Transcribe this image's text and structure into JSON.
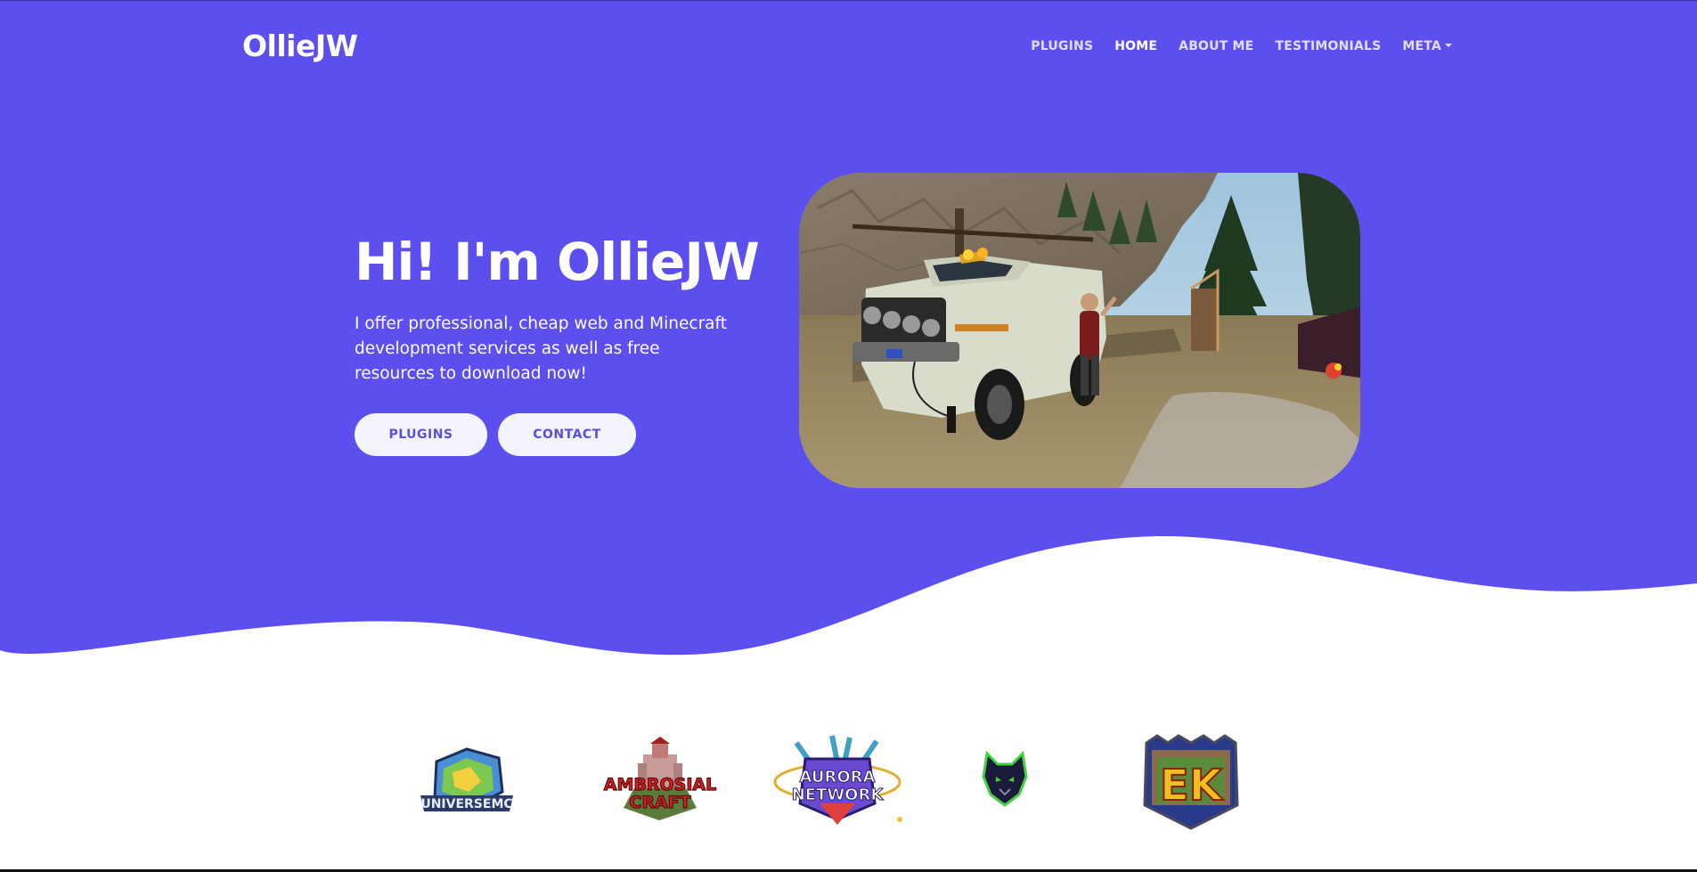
{
  "colors": {
    "accent": "#5d4fee",
    "button_bg": "#f2f3fb",
    "button_text": "#5b4fe0",
    "white": "#ffffff"
  },
  "navbar": {
    "brand": "OllieJW",
    "links": [
      {
        "label": "PLUGINS",
        "active": false
      },
      {
        "label": "HOME",
        "active": true
      },
      {
        "label": "ABOUT ME",
        "active": false
      },
      {
        "label": "TESTIMONIALS",
        "active": false
      },
      {
        "label": "META",
        "active": false,
        "dropdown": true
      }
    ]
  },
  "hero": {
    "title": "Hi! I'm OllieJW",
    "description": "I offer professional, cheap web and Minecraft development services as well as free resources to download now!",
    "buttons": {
      "plugins": "PLUGINS",
      "contact": "CONTACT"
    },
    "image": "truck-screenshot"
  },
  "partner_logos": {
    "universemc": {
      "name": "universemc-logo",
      "text": "UNIVERSEMC"
    },
    "ambrosial": {
      "name": "ambrosial-craft-logo",
      "line1": "AMBROSIAL",
      "line2": "CRAFT"
    },
    "aurora": {
      "name": "aurora-network-logo",
      "line1": "AURORA",
      "line2": "NETWORK"
    },
    "wolf": {
      "name": "wolf-logo"
    },
    "ek": {
      "name": "ek-logo",
      "text": "EK"
    }
  }
}
